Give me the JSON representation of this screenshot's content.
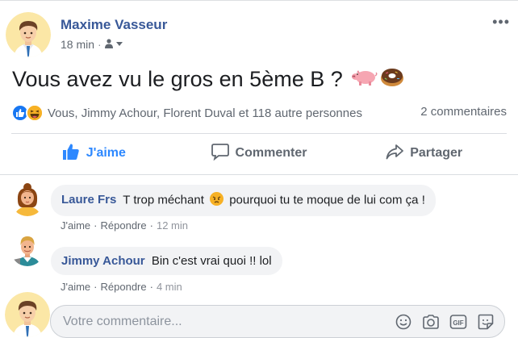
{
  "post": {
    "author": "Maxime Vasseur",
    "time": "18 min",
    "audience_icon": "friends-icon",
    "text": "Vous avez vu le gros en 5ème B ?",
    "emojis": [
      "pig-icon",
      "donut-icon"
    ],
    "reactions": {
      "icons": [
        "like-icon",
        "haha-icon"
      ],
      "names": "Vous, Jimmy Achour, Florent Duval et",
      "others": "118 autre personnes"
    },
    "comments_count": "2 commentaires"
  },
  "actions": {
    "like": "J'aime",
    "comment": "Commenter",
    "share": "Partager"
  },
  "comments": [
    {
      "name": "Laure Frs",
      "text_before": "T trop méchant",
      "emoji": "angry-face-icon",
      "text_after": "pourquoi tu te moque de lui com ça !",
      "like": "J'aime",
      "reply": "Répondre",
      "time": "12 min"
    },
    {
      "name": "Jimmy Achour",
      "text": "Bin c'est vrai quoi !! lol",
      "like": "J'aime",
      "reply": "Répondre",
      "time": "4 min"
    }
  ],
  "composer": {
    "placeholder": "Votre commentaire..."
  },
  "colors": {
    "name_blue": "#385898",
    "like_blue": "#2d88ff",
    "grey_text": "#606770"
  }
}
